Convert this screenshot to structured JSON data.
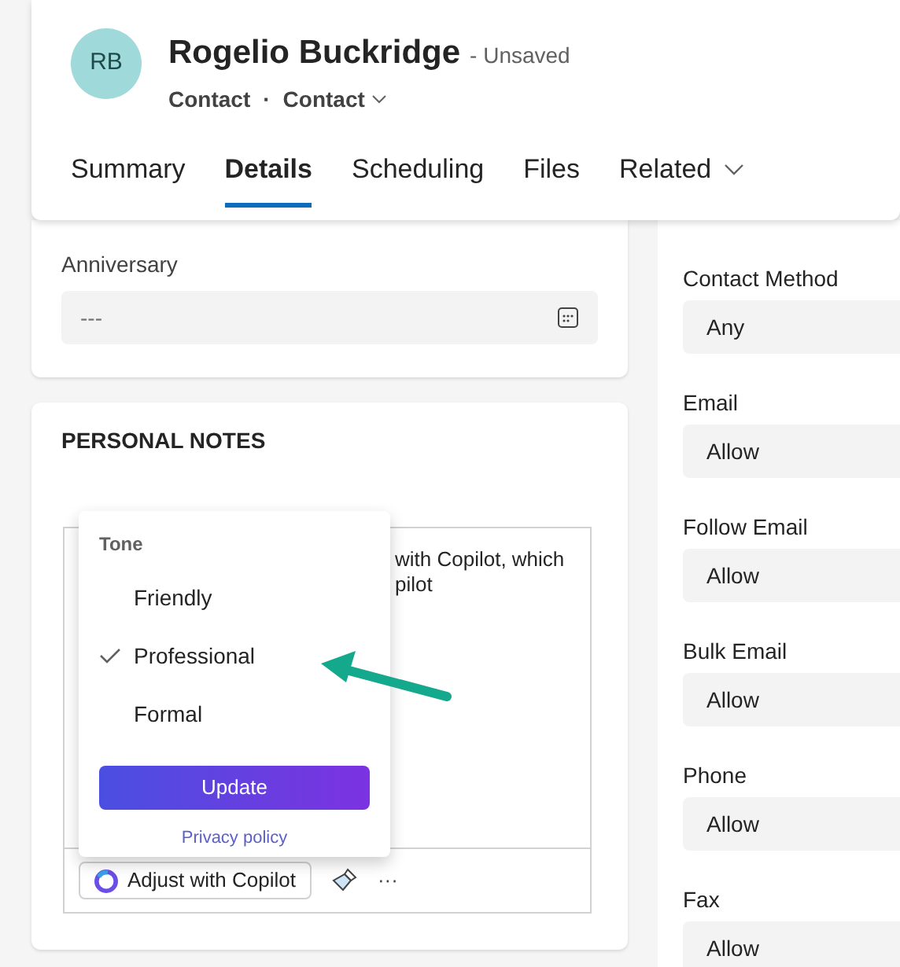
{
  "header": {
    "initials": "RB",
    "name": "Rogelio Buckridge",
    "status": "- Unsaved",
    "entity": "Contact",
    "separator": "·",
    "form": "Contact"
  },
  "tabs": [
    {
      "label": "Summary",
      "selected": false,
      "dropdown": false
    },
    {
      "label": "Details",
      "selected": true,
      "dropdown": false
    },
    {
      "label": "Scheduling",
      "selected": false,
      "dropdown": false
    },
    {
      "label": "Files",
      "selected": false,
      "dropdown": false
    },
    {
      "label": "Related",
      "selected": false,
      "dropdown": true
    }
  ],
  "anniversary": {
    "label": "Anniversary",
    "placeholder": "---"
  },
  "notes": {
    "title": "PERSONAL NOTES",
    "text_lines": [
      "with Copilot, which",
      "pilot"
    ],
    "copilot_button": "Adjust with Copilot",
    "more": "···"
  },
  "tone_menu": {
    "title": "Tone",
    "options": [
      {
        "label": "Friendly",
        "selected": false
      },
      {
        "label": "Professional",
        "selected": true
      },
      {
        "label": "Formal",
        "selected": false
      }
    ],
    "update": "Update",
    "privacy": "Privacy policy"
  },
  "fields": [
    {
      "label": "Contact Method",
      "value": "Any"
    },
    {
      "label": "Email",
      "value": "Allow"
    },
    {
      "label": "Follow Email",
      "value": "Allow"
    },
    {
      "label": "Bulk Email",
      "value": "Allow"
    },
    {
      "label": "Phone",
      "value": "Allow"
    },
    {
      "label": "Fax",
      "value": "Allow"
    }
  ]
}
